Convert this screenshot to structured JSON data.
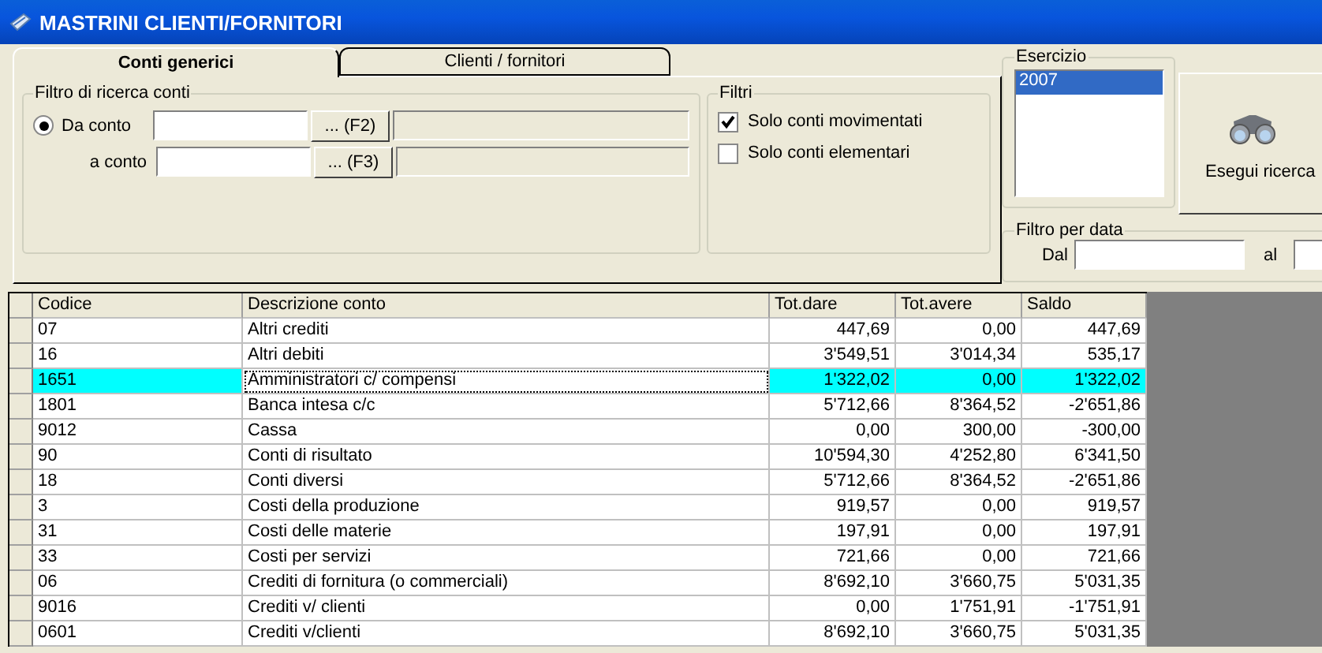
{
  "window": {
    "title": "MASTRINI CLIENTI/FORNITORI"
  },
  "tabs": [
    {
      "label": "Conti generici",
      "selected": true
    },
    {
      "label": "Clienti / fornitori",
      "selected": false
    }
  ],
  "account_filter": {
    "title": "Filtro di ricerca conti",
    "fields": [
      {
        "label": "Da conto",
        "selected": true,
        "button": "... (F2)"
      },
      {
        "label": "a conto",
        "button": "... (F3)"
      }
    ]
  },
  "filters": {
    "title": "Filtri",
    "options": [
      {
        "label": "Solo conti movimentati",
        "checked": true
      },
      {
        "label": "Solo conti elementari",
        "checked": false
      }
    ]
  },
  "fiscal_year": {
    "title": "Esercizio",
    "items": [
      {
        "label": "2007",
        "selected": true
      }
    ]
  },
  "search_button": {
    "label": "Esegui ricerca"
  },
  "date_filter": {
    "title": "Filtro per data",
    "from_label": "Dal",
    "to_label": "al"
  },
  "table": {
    "columns": [
      "Codice",
      "Descrizione conto",
      "Tot.dare",
      "Tot.avere",
      "Saldo"
    ],
    "rows": [
      {
        "cells": [
          "07",
          "Altri crediti",
          "447,69",
          "0,00",
          "447,69"
        ],
        "selected": false
      },
      {
        "cells": [
          "16",
          "Altri debiti",
          "3'549,51",
          "3'014,34",
          "535,17"
        ],
        "selected": false
      },
      {
        "cells": [
          "1651",
          "Amministratori c/ compensi",
          "1'322,02",
          "0,00",
          "1'322,02"
        ],
        "selected": true
      },
      {
        "cells": [
          "1801",
          "Banca intesa c/c",
          "5'712,66",
          "8'364,52",
          "-2'651,86"
        ],
        "selected": false
      },
      {
        "cells": [
          "9012",
          "Cassa",
          "0,00",
          "300,00",
          "-300,00"
        ],
        "selected": false
      },
      {
        "cells": [
          "90",
          "Conti di risultato",
          "10'594,30",
          "4'252,80",
          "6'341,50"
        ],
        "selected": false
      },
      {
        "cells": [
          "18",
          "Conti diversi",
          "5'712,66",
          "8'364,52",
          "-2'651,86"
        ],
        "selected": false
      },
      {
        "cells": [
          "3",
          "Costi della produzione",
          "919,57",
          "0,00",
          "919,57"
        ],
        "selected": false
      },
      {
        "cells": [
          "31",
          "Costi delle materie",
          "197,91",
          "0,00",
          "197,91"
        ],
        "selected": false
      },
      {
        "cells": [
          "33",
          "Costi per servizi",
          "721,66",
          "0,00",
          "721,66"
        ],
        "selected": false
      },
      {
        "cells": [
          "06",
          "Crediti di fornitura (o commerciali)",
          "8'692,10",
          "3'660,75",
          "5'031,35"
        ],
        "selected": false
      },
      {
        "cells": [
          "9016",
          "Crediti v/ clienti",
          "0,00",
          "1'751,91",
          "-1'751,91"
        ],
        "selected": false
      },
      {
        "cells": [
          "0601",
          "Crediti v/clienti",
          "8'692,10",
          "3'660,75",
          "5'031,35"
        ],
        "selected": false
      }
    ]
  }
}
